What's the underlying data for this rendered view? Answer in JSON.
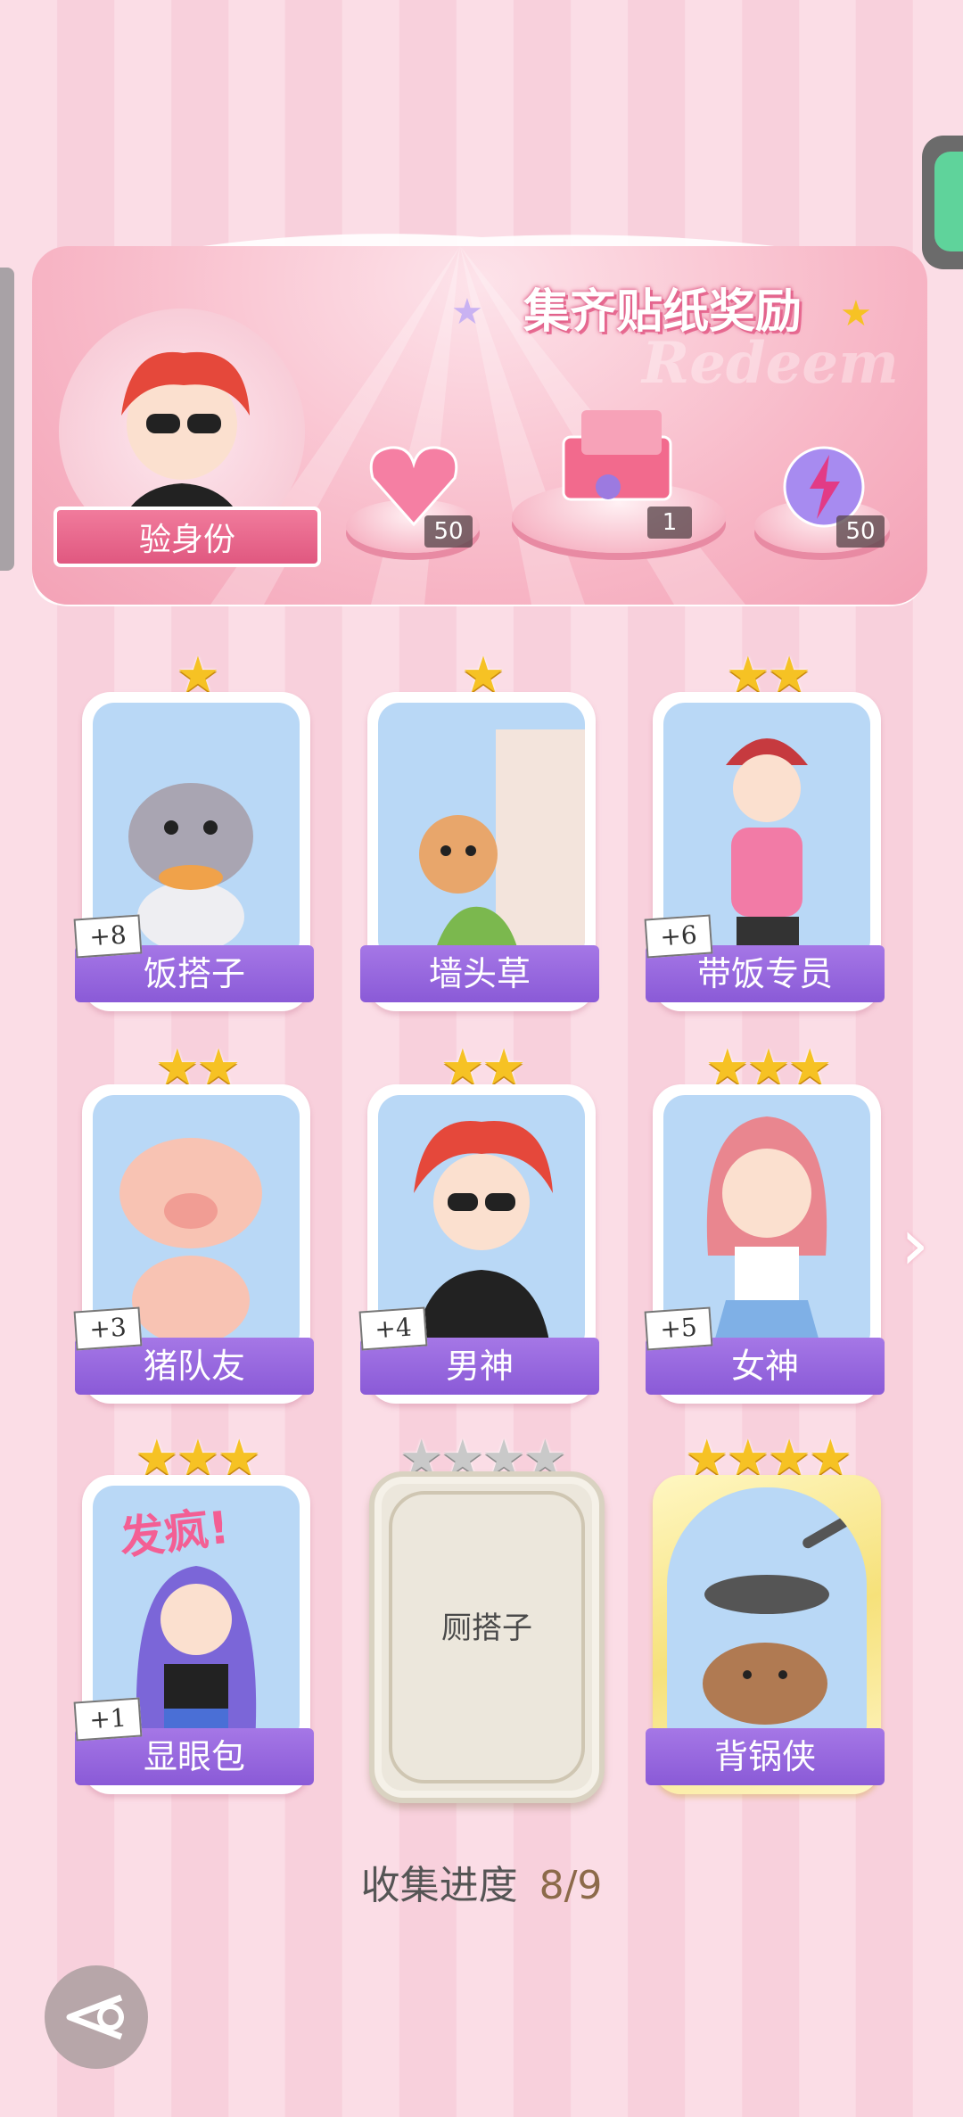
{
  "banner": {
    "title": "集齐贴纸奖励",
    "watermark": "Redeem",
    "verify_label": "验身份",
    "rewards": [
      {
        "icon": "pink-heart-gem-icon",
        "count": "50"
      },
      {
        "icon": "gift-box-icon",
        "count": "1"
      },
      {
        "icon": "lightning-orb-icon",
        "count": "50"
      }
    ]
  },
  "cards": [
    {
      "name": "饭搭子",
      "stars": "★",
      "bonus": "+8",
      "art": "cat-with-pancake-icon"
    },
    {
      "name": "墙头草",
      "stars": "★",
      "bonus": "",
      "art": "cat-behind-wall-icon"
    },
    {
      "name": "带饭专员",
      "stars": "★★",
      "bonus": "+6",
      "art": "girl-with-phone-icon"
    },
    {
      "name": "猪队友",
      "stars": "★★",
      "bonus": "+3",
      "art": "pig-icon"
    },
    {
      "name": "男神",
      "stars": "★★",
      "bonus": "+4",
      "art": "boy-with-sunglasses-icon"
    },
    {
      "name": "女神",
      "stars": "★★★",
      "bonus": "+5",
      "art": "girl-in-sailor-uniform-icon"
    },
    {
      "name": "显眼包",
      "stars": "★★★",
      "bonus": "+1",
      "art": "crazy-girl-icon",
      "art_text": "发疯!"
    },
    {
      "name": "厕搭子",
      "stars": "★★★★",
      "bonus": "",
      "art": "locked-card-icon"
    },
    {
      "name": "背锅侠",
      "stars": "★★★★",
      "bonus": "",
      "art": "capybara-with-pan-icon"
    }
  ],
  "progress": {
    "label": "收集进度",
    "value": "8/9"
  },
  "colors": {
    "card_purple": "#8a5ad7",
    "star_gold": "#f6c224",
    "banner_pink": "#f3a2b6"
  }
}
